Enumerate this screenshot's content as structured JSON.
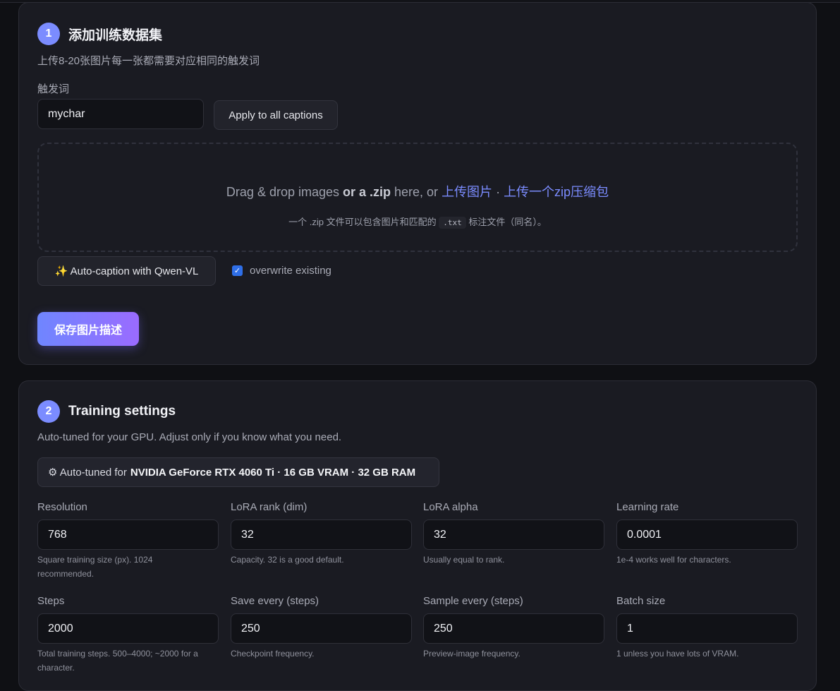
{
  "step1": {
    "number": "1",
    "title": "添加训练数据集",
    "description": "上传8-20张图片每一张都需要对应相同的触发词",
    "trigger_label": "触发词",
    "trigger_value": "mychar",
    "apply_button": "Apply to all captions",
    "dropzone": {
      "text_prefix": "Drag & drop images ",
      "text_bold": "or a .zip",
      "text_mid": " here, or ",
      "link_images": "上传图片",
      "separator": " · ",
      "link_zip": "上传一个zip压缩包",
      "sub_prefix": "一个 .zip 文件可以包含图片和匹配的",
      "sub_code": ".txt",
      "sub_suffix": "标注文件（同名）。"
    },
    "autocaption_icon": "sparkles-icon",
    "autocaption_label": "✨ Auto-caption with Qwen-VL",
    "overwrite_label": "overwrite existing",
    "overwrite_checked": true,
    "save_button": "保存图片描述"
  },
  "step2": {
    "number": "2",
    "title": "Training settings",
    "description": "Auto-tuned for your GPU. Adjust only if you know what you need.",
    "gpu_icon": "gear-icon",
    "gpu_prefix": "⚙ Auto-tuned for",
    "gpu_detail": "NVIDIA GeForce RTX 4060 Ti · 16 GB VRAM · 32 GB RAM",
    "fields": [
      {
        "label": "Resolution",
        "value": "768",
        "hint": "Square training size (px). 1024 recommended."
      },
      {
        "label": "LoRA rank (dim)",
        "value": "32",
        "hint": "Capacity. 32 is a good default."
      },
      {
        "label": "LoRA alpha",
        "value": "32",
        "hint": "Usually equal to rank."
      },
      {
        "label": "Learning rate",
        "value": "0.0001",
        "hint": "1e-4 works well for characters."
      },
      {
        "label": "Steps",
        "value": "2000",
        "hint": "Total training steps. 500–4000; ~2000 for a character."
      },
      {
        "label": "Save every (steps)",
        "value": "250",
        "hint": "Checkpoint frequency."
      },
      {
        "label": "Sample every (steps)",
        "value": "250",
        "hint": "Preview-image frequency."
      },
      {
        "label": "Batch size",
        "value": "1",
        "hint": "1 unless you have lots of VRAM."
      }
    ]
  }
}
